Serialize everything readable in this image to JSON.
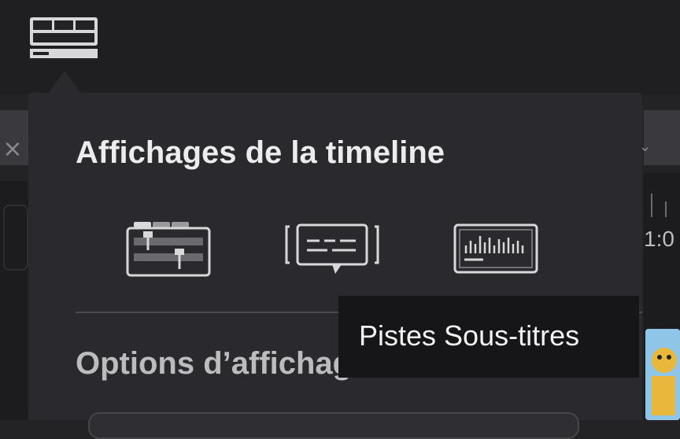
{
  "toolbar": {
    "timeline_view_button": "timeline-view-options-icon"
  },
  "background": {
    "close_icon": "×",
    "chevron_icon": "⌄",
    "ruler_label": "1:0"
  },
  "popover": {
    "title": "Affichages de la timeline",
    "views": [
      {
        "icon": "stacked-timeline-icon"
      },
      {
        "icon": "subtitle-tracks-icon"
      },
      {
        "icon": "audio-waveform-icon"
      }
    ],
    "section2_title": "Options d’affichage vidéo"
  },
  "tooltip": {
    "text": "Pistes Sous-titres"
  },
  "colors": {
    "popover_bg": "#2a2a2e",
    "tooltip_bg": "#161618",
    "icon_stroke": "#d8d8da"
  }
}
